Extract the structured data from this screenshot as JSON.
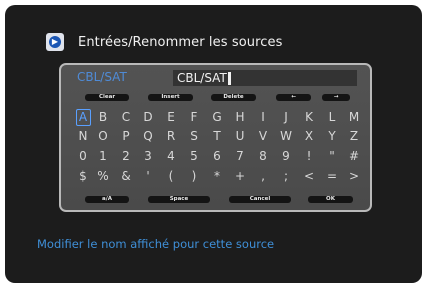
{
  "header": {
    "title": "Entrées/Renommer les sources",
    "icon": "source-rename-icon"
  },
  "source_label": "CBL/SAT",
  "name_field": {
    "value": "CBL/SAT"
  },
  "top_buttons": [
    "Clear",
    "Insert",
    "Delete",
    "←",
    "→"
  ],
  "keys": [
    [
      "A",
      "B",
      "C",
      "D",
      "E",
      "F",
      "G",
      "H",
      "I",
      "J",
      "K",
      "L",
      "M"
    ],
    [
      "N",
      "O",
      "P",
      "Q",
      "R",
      "S",
      "T",
      "U",
      "V",
      "W",
      "X",
      "Y",
      "Z"
    ],
    [
      "0",
      "1",
      "2",
      "3",
      "4",
      "5",
      "6",
      "7",
      "8",
      "9",
      "!",
      "\"",
      "#"
    ],
    [
      "$",
      "%",
      "&",
      "'",
      "(",
      ")",
      "*",
      "+",
      ",",
      ";",
      "<",
      "=",
      ">"
    ]
  ],
  "selected_key": "A",
  "bottom_buttons": [
    "a/A",
    "Space",
    "Cancel",
    "OK"
  ],
  "footer_text": "Modifier le nom affiché pour cette source",
  "colors": {
    "accent": "#4f8bd6",
    "background": "#1c1c1c",
    "panel": "#4e4e4e"
  }
}
